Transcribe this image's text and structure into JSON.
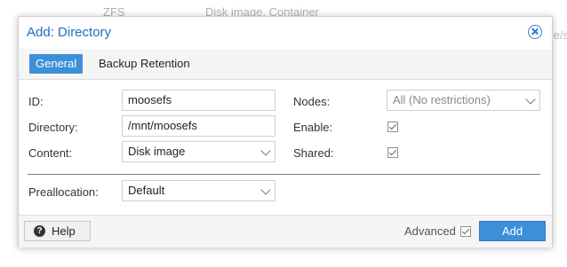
{
  "background": {
    "col1": "ZFS",
    "col2": "Disk image, Container",
    "edge_text": "/e/sh"
  },
  "dialog": {
    "title": "Add: Directory",
    "close_icon": "close-circle-icon"
  },
  "tabs": [
    {
      "label": "General",
      "active": true
    },
    {
      "label": "Backup Retention",
      "active": false
    }
  ],
  "form": {
    "id": {
      "label": "ID:",
      "value": "moosefs"
    },
    "directory": {
      "label": "Directory:",
      "value": "/mnt/moosefs"
    },
    "content": {
      "label": "Content:",
      "value": "Disk image"
    },
    "nodes": {
      "label": "Nodes:",
      "value": "All (No restrictions)"
    },
    "enable": {
      "label": "Enable:",
      "checked": true
    },
    "shared": {
      "label": "Shared:",
      "checked": true
    },
    "preallocation": {
      "label": "Preallocation:",
      "value": "Default"
    }
  },
  "footer": {
    "help_label": "Help",
    "help_icon": "question-circle-icon",
    "advanced_label": "Advanced",
    "advanced_checked": true,
    "add_label": "Add"
  },
  "colors": {
    "accent": "#3d8fd8",
    "title": "#1f6fbe"
  }
}
